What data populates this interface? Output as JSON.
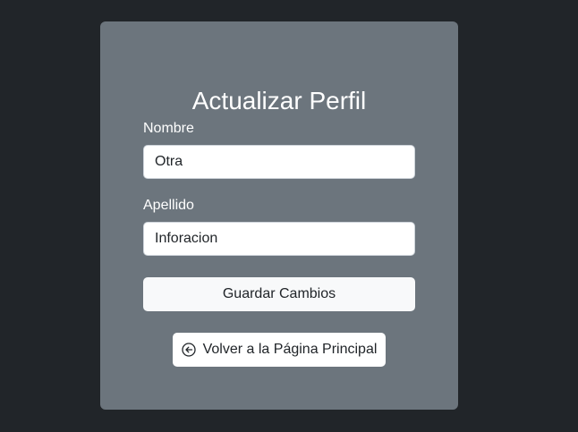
{
  "form": {
    "title": "Actualizar Perfil",
    "nombre_label": "Nombre",
    "nombre_value": "Otra",
    "apellido_label": "Apellido",
    "apellido_value": "Inforacion",
    "save_label": "Guardar Cambios",
    "back_label": "Volver a la Página Principal",
    "back_icon": "arrow-left-circle-icon"
  },
  "colors": {
    "page_background": "#212529",
    "card_background": "#6c757d",
    "button_background": "#f8f9fa"
  }
}
